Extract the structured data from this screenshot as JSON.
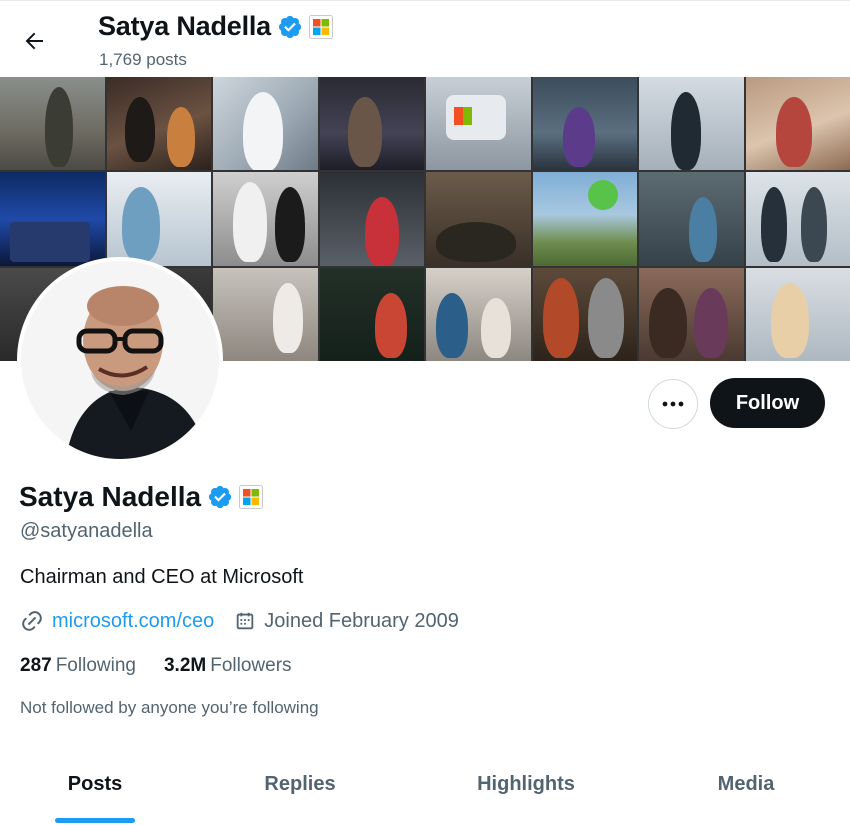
{
  "header": {
    "name": "Satya Nadella",
    "posts_count": "1,769 posts"
  },
  "profile": {
    "name": "Satya Nadella",
    "handle": "@satyanadella",
    "bio": "Chairman and CEO at Microsoft",
    "website": "microsoft.com/ceo",
    "joined": "Joined February 2009",
    "following_count": "287",
    "following_label": "Following",
    "followers_count": "3.2M",
    "followers_label": "Followers",
    "followed_by": "Not followed by anyone you’re following"
  },
  "actions": {
    "more_label": "•••",
    "follow_label": "Follow"
  },
  "tabs": [
    {
      "label": "Posts",
      "active": true
    },
    {
      "label": "Replies",
      "active": false
    },
    {
      "label": "Highlights",
      "active": false
    },
    {
      "label": "Media",
      "active": false
    }
  ],
  "colors": {
    "accent": "#1d9bf0",
    "text": "#0f1419",
    "muted": "#536471",
    "verified": "#1d9bf0"
  },
  "icons": {
    "back": "arrow-left-icon",
    "verified": "verified-badge-icon",
    "affiliate": "microsoft-logo-icon",
    "more": "more-icon",
    "link": "link-icon",
    "calendar": "calendar-icon"
  }
}
